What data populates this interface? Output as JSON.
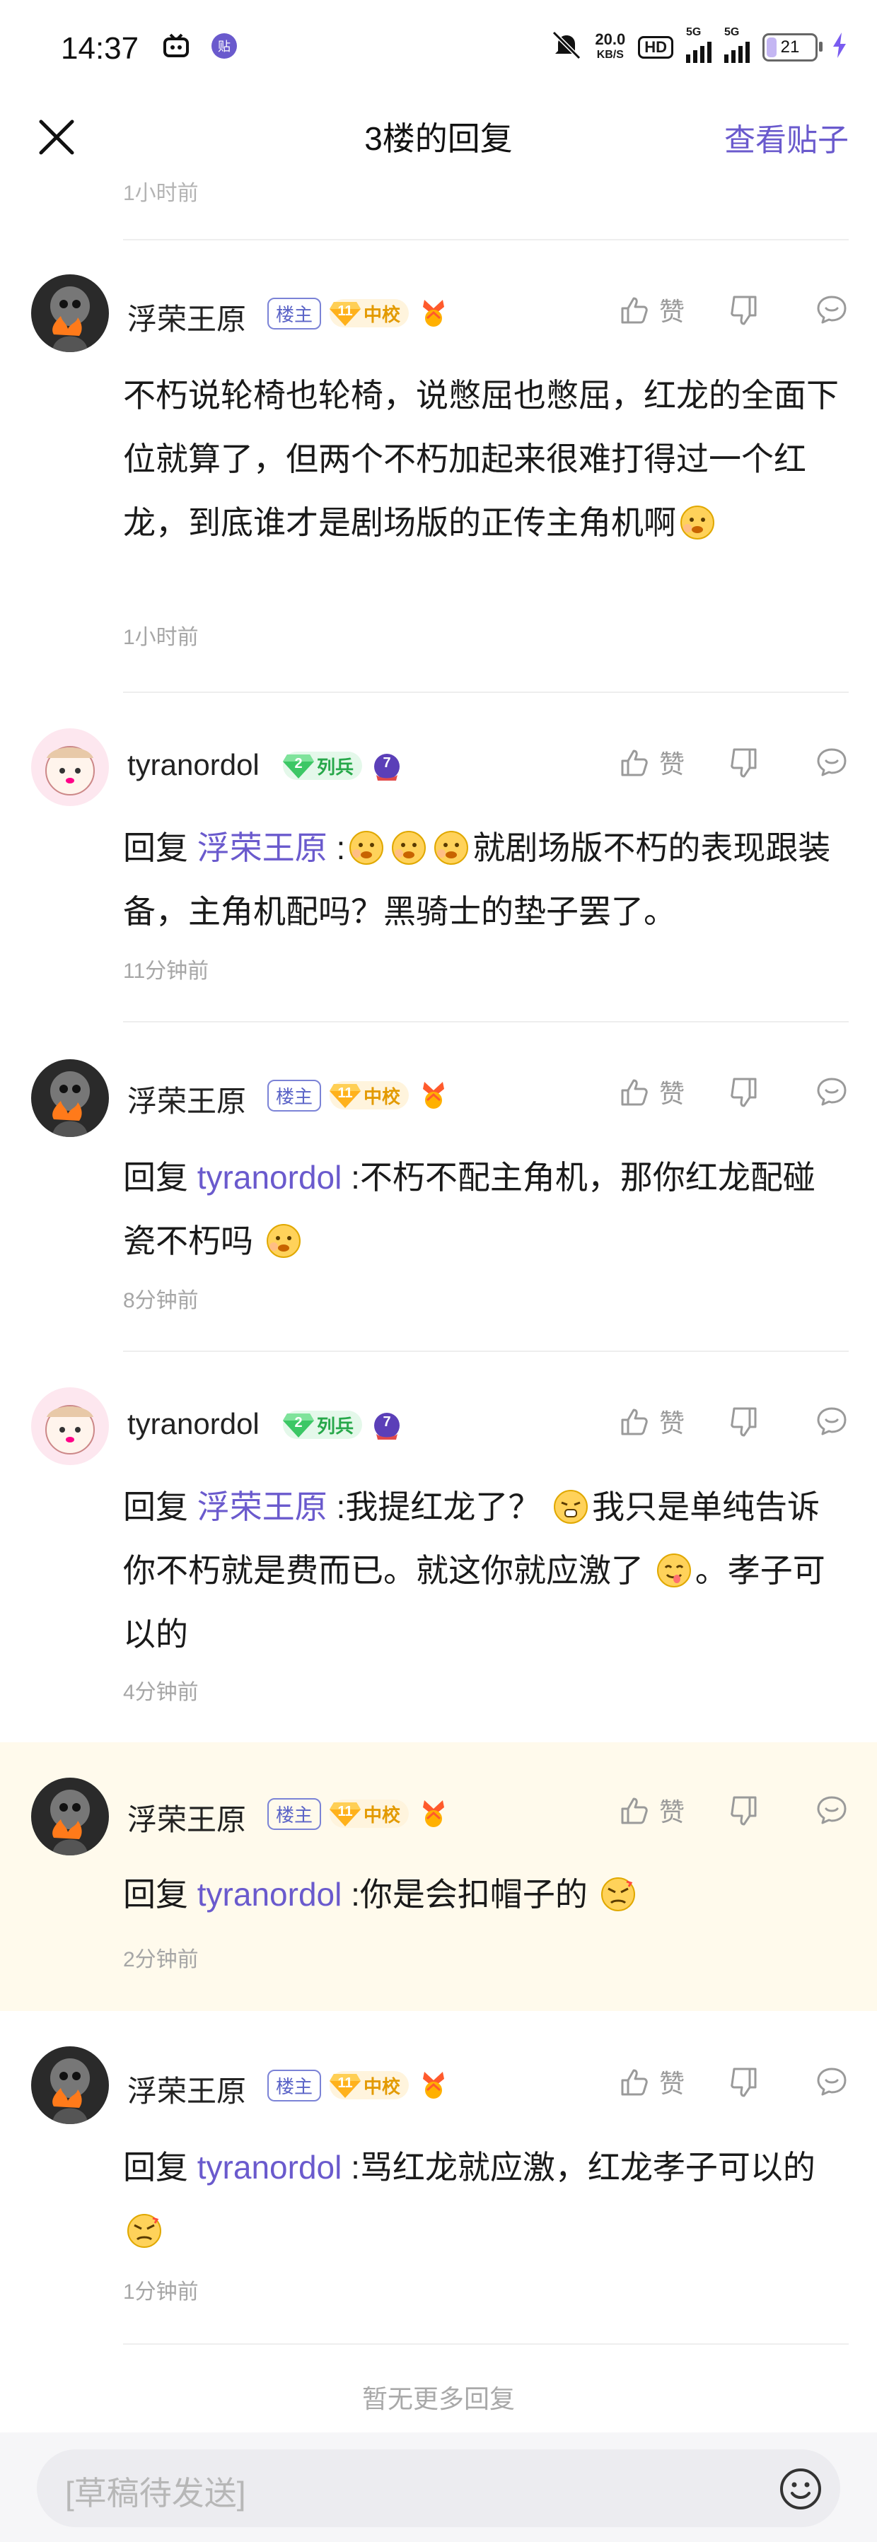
{
  "status_bar": {
    "time": "14:37",
    "net_speed": "20.0",
    "net_unit": "KB/S",
    "hd_label": "HD",
    "sig1_label": "5G",
    "sig2_label": "5G",
    "battery": "21",
    "battery_level": 0.21,
    "icons": [
      "tv-icon",
      "baidu-icon",
      "mute-icon",
      "signal-icon",
      "battery-icon",
      "charging-icon"
    ]
  },
  "nav": {
    "title": "3楼的回复",
    "right_link": "查看贴子"
  },
  "previous_time": "1小时前",
  "badges": {
    "owner": "楼主",
    "level_11": "11",
    "level_11_title": "中校",
    "level_2": "2",
    "level_2_title": "列兵",
    "medal_7": "7"
  },
  "actions": {
    "like": "赞"
  },
  "reply_prefix": "回复",
  "comments": [
    {
      "user": "浮荣王原",
      "text_parts": [
        "不朽说轮椅也轮椅，说憋屈也憋屈，红龙的全面下位就算了，但两个不朽加起来很难打得过一个红龙，到底谁才是剧场版的正传主角机啊"
      ],
      "time": "1小时前"
    },
    {
      "user": "tyranordol",
      "reply_to": "浮荣王原",
      "text_parts": [
        " :",
        "就剧场版不朽的表现跟装备，主角机配吗？黑骑士的垫子罢了。"
      ],
      "time": "11分钟前"
    },
    {
      "user": "浮荣王原",
      "reply_to": "tyranordol",
      "text_parts": [
        " :不朽不配主角机，那你红龙配碰瓷不朽吗 "
      ],
      "time": "8分钟前"
    },
    {
      "user": "tyranordol",
      "reply_to": "浮荣王原",
      "text_parts": [
        " :我提红龙了？ ",
        "我只是单纯告诉你不朽就是费而已。就这你就应激了 ",
        "。孝子可以的"
      ],
      "time": "4分钟前"
    },
    {
      "user": "浮荣王原",
      "reply_to": "tyranordol",
      "text_parts": [
        " :你是会扣帽子的 "
      ],
      "time": "2分钟前"
    },
    {
      "user": "浮荣王原",
      "reply_to": "tyranordol",
      "text_parts": [
        " :骂红龙就应激，红龙孝子可以的 "
      ],
      "time": "1分钟前"
    }
  ],
  "no_more": "暂无更多回复",
  "input": {
    "placeholder": "[草稿待发送]"
  },
  "colors": {
    "accent": "#6a5acd",
    "highlight_bg": "#fffaec",
    "owner_badge": "#5b64c7",
    "level_gold": "#e39a00",
    "level_green": "#27a84a"
  }
}
